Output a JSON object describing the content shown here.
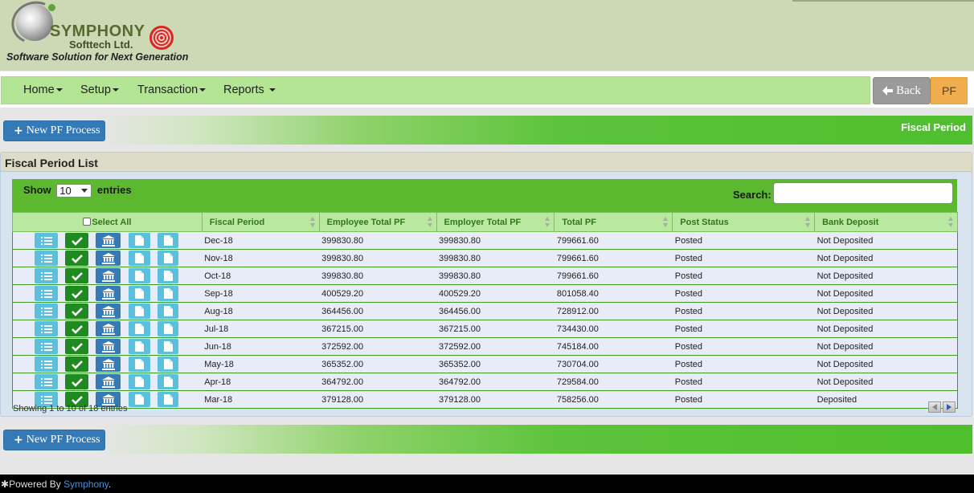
{
  "brand": {
    "name": "SYMPHONY",
    "sub": "Softtech Ltd.",
    "tagline": "Software Solution for Next Generation"
  },
  "nav": {
    "items": [
      {
        "label": "Home"
      },
      {
        "label": "Setup"
      },
      {
        "label": "Transaction"
      },
      {
        "label": "Reports"
      }
    ],
    "back_label": "Back",
    "pf_label": "PF"
  },
  "actions": {
    "new_label": "New PF Process",
    "bar_title": "Fiscal Period"
  },
  "panel": {
    "title": "Fiscal Period List",
    "show_prefix": "Show",
    "show_value": "10",
    "show_suffix": "entries",
    "search_label": "Search:",
    "search_value": "",
    "select_all_label": "Select All",
    "columns": [
      "Fiscal Period",
      "Employee Total PF",
      "Employer Total PF",
      "Total PF",
      "Post Status",
      "Bank Deposit"
    ],
    "rows": [
      [
        "Dec-18",
        "399830.80",
        "399830.80",
        "799661.60",
        "Posted",
        "Not Deposited"
      ],
      [
        "Nov-18",
        "399830.80",
        "399830.80",
        "799661.60",
        "Posted",
        "Not Deposited"
      ],
      [
        "Oct-18",
        "399830.80",
        "399830.80",
        "799661.60",
        "Posted",
        "Not Deposited"
      ],
      [
        "Sep-18",
        "400529.20",
        "400529.20",
        "801058.40",
        "Posted",
        "Not Deposited"
      ],
      [
        "Aug-18",
        "364456.00",
        "364456.00",
        "728912.00",
        "Posted",
        "Not Deposited"
      ],
      [
        "Jul-18",
        "367215.00",
        "367215.00",
        "734430.00",
        "Posted",
        "Not Deposited"
      ],
      [
        "Jun-18",
        "372592.00",
        "372592.00",
        "745184.00",
        "Posted",
        "Not Deposited"
      ],
      [
        "May-18",
        "365352.00",
        "365352.00",
        "730704.00",
        "Posted",
        "Not Deposited"
      ],
      [
        "Apr-18",
        "364792.00",
        "364792.00",
        "729584.00",
        "Posted",
        "Not Deposited"
      ],
      [
        "Mar-18",
        "379128.00",
        "379128.00",
        "758256.00",
        "Posted",
        "Deposited"
      ]
    ],
    "row_icons": [
      "list-icon",
      "check-icon",
      "bank-icon",
      "document-icon",
      "document-icon"
    ],
    "info": "Showing 1 to 10 of 18 entries"
  },
  "footer": {
    "prefix": "Powered By",
    "link": "Symphony",
    "suffix": "."
  },
  "colors": {
    "header_bg": "#cdd9b5",
    "navbar_bg": "#b3e594",
    "accent_green": "#4fbf2e",
    "primary_blue": "#337ab7",
    "info_cyan": "#5bc0de",
    "success_green": "#1f8a1f",
    "warning_orange": "#f0ad4e"
  }
}
